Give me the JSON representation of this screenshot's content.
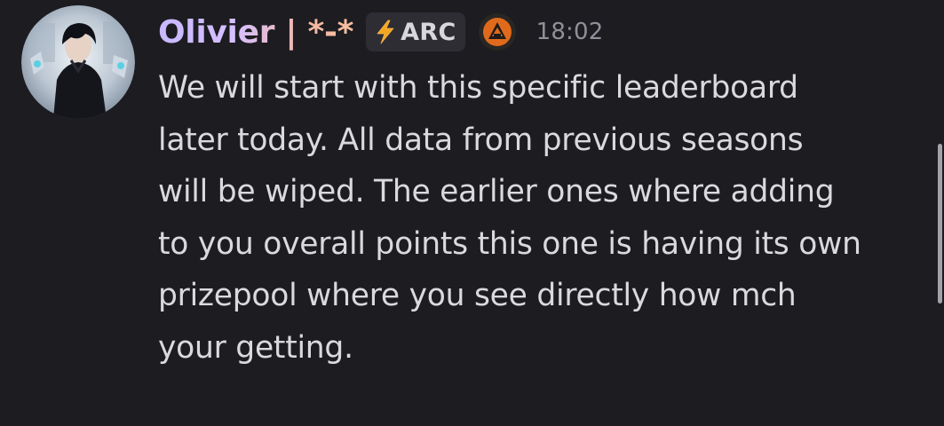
{
  "message": {
    "author": {
      "username": "Olivier | *-*",
      "tag": "ARC",
      "tag_icon": "lightning-bolt-icon",
      "role_icon": "orange-triangle-badge-icon"
    },
    "timestamp": "18:02",
    "content_lines": [
      "We will start with this specific leaderboard",
      "later today. All data from previous seasons",
      "will be wiped. The earlier ones where adding",
      "to you overall points this one is having its own",
      "prizepool where you see directly how mch",
      "your getting."
    ]
  },
  "colors": {
    "background": "#1c1c21",
    "text": "#d9d9de",
    "timestamp": "#909099",
    "tag_background": "#2d2d33",
    "username_gradient_start": "#c8b8ff",
    "username_gradient_end": "#f6c0a0",
    "tag_bolt": "#f5a623",
    "role_icon": "#e06a1c"
  }
}
